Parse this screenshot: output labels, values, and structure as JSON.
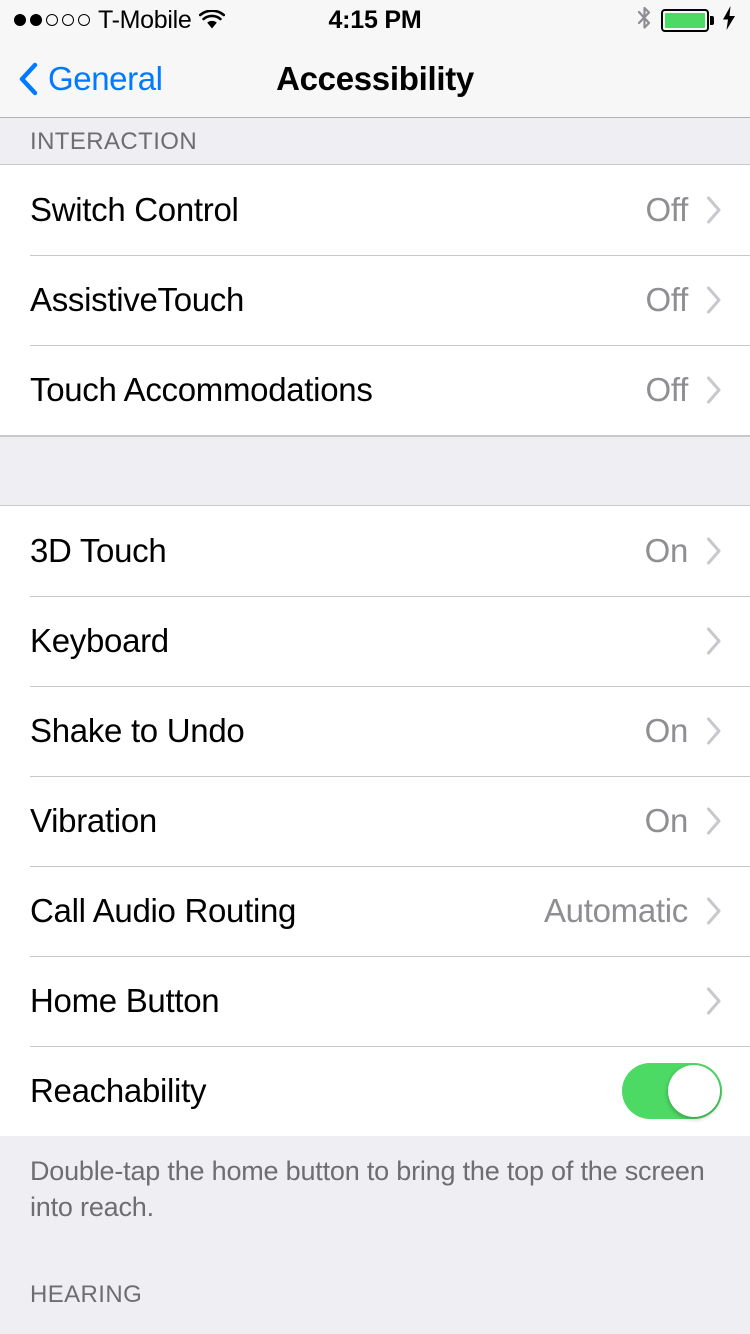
{
  "status_bar": {
    "signal_dots_filled": 2,
    "signal_dots_total": 5,
    "carrier": "T-Mobile",
    "wifi_icon": "wifi-icon",
    "time": "4:15 PM",
    "bluetooth_icon": "bluetooth-icon",
    "battery_icon": "battery-icon",
    "battery_level_percent": 100,
    "charging_icon": "lightning-bolt-icon",
    "battery_color": "#4CD964"
  },
  "nav": {
    "back_label": "General",
    "back_icon": "chevron-left-icon",
    "title": "Accessibility",
    "accent_color": "#007AFF"
  },
  "sections": [
    {
      "header": "INTERACTION",
      "rows": [
        {
          "label": "Switch Control",
          "value": "Off",
          "accessory": "chevron"
        },
        {
          "label": "AssistiveTouch",
          "value": "Off",
          "accessory": "chevron"
        },
        {
          "label": "Touch Accommodations",
          "value": "Off",
          "accessory": "chevron"
        }
      ]
    },
    {
      "header": "",
      "rows": [
        {
          "label": "3D Touch",
          "value": "On",
          "accessory": "chevron"
        },
        {
          "label": "Keyboard",
          "value": "",
          "accessory": "chevron"
        },
        {
          "label": "Shake to Undo",
          "value": "On",
          "accessory": "chevron"
        },
        {
          "label": "Vibration",
          "value": "On",
          "accessory": "chevron"
        },
        {
          "label": "Call Audio Routing",
          "value": "Automatic",
          "accessory": "chevron"
        },
        {
          "label": "Home Button",
          "value": "",
          "accessory": "chevron"
        },
        {
          "label": "Reachability",
          "value": "",
          "accessory": "toggle",
          "toggle_on": true
        }
      ],
      "footer": "Double-tap the home button to bring the top of the screen into reach."
    }
  ],
  "next_section_header": "HEARING",
  "colors": {
    "group_background": "#FFFFFF",
    "page_background": "#EFEEF3",
    "separator": "#C8C7CC",
    "secondary_text": "#8E8E93",
    "footer_text": "#6D6D72",
    "chevron": "#C7C7CC",
    "toggle_on": "#4CD964"
  }
}
